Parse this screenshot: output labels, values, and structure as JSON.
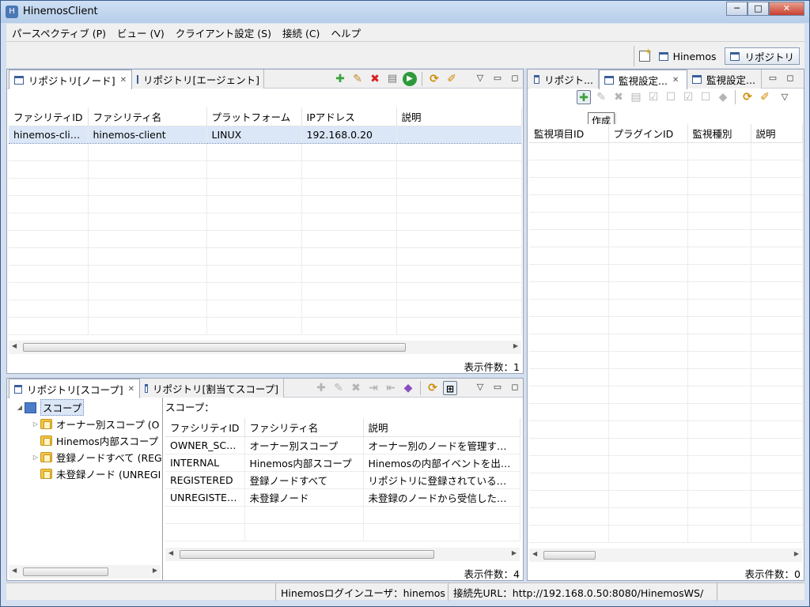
{
  "window": {
    "title": "HinemosClient",
    "minimize": "─",
    "maximize": "□",
    "close": "✕"
  },
  "menu": [
    "パースペクティブ (P)",
    "ビュー (V)",
    "クライアント設定 (S)",
    "接続 (C)",
    "ヘルプ"
  ],
  "perspectives": {
    "items": [
      "Hinemos",
      "リポジトリ"
    ],
    "active": "リポジトリ"
  },
  "node_panel": {
    "tabs": [
      {
        "label": "リポジトリ[ノード]",
        "active": true,
        "closable": true
      },
      {
        "label": "リポジトリ[エージェント]",
        "active": false,
        "closable": false
      }
    ],
    "columns": [
      "ファシリティID",
      "ファシリティ名",
      "プラットフォーム",
      "IPアドレス",
      "説明"
    ],
    "rows": [
      [
        "hinemos-client",
        "hinemos-client",
        "LINUX",
        "192.168.0.20",
        ""
      ]
    ],
    "count_label": "表示件数：1"
  },
  "scope_panel": {
    "tabs": [
      {
        "label": "リポジトリ[スコープ]",
        "active": true,
        "closable": true
      },
      {
        "label": "リポジトリ[割当てスコープ]",
        "active": false,
        "closable": false
      }
    ],
    "tree_root": "スコープ",
    "tree_items": [
      {
        "label": "オーナー別スコープ (O",
        "expandable": true
      },
      {
        "label": "Hinemos内部スコープ",
        "expandable": false
      },
      {
        "label": "登録ノードすべて (REG",
        "expandable": true
      },
      {
        "label": "未登録ノード (UNREGI",
        "expandable": false
      }
    ],
    "scope_label": "スコープ：",
    "columns": [
      "ファシリティID",
      "ファシリティ名",
      "説明"
    ],
    "rows": [
      [
        "OWNER_SCO...",
        "オーナー別スコープ",
        "オーナー別のノードを管理する..."
      ],
      [
        "INTERNAL",
        "Hinemos内部スコープ",
        "Hinemosの内部イベントを出力..."
      ],
      [
        "REGISTERED",
        "登録ノードすべて",
        "リポジトリに登録されているす..."
      ],
      [
        "UNREGISTER...",
        "未登録ノード",
        "未登録のノードから受信した通..."
      ]
    ],
    "count_label": "表示件数：4"
  },
  "monitor_panel": {
    "tabs": [
      {
        "label": "リポジト...",
        "active": false,
        "closable": false
      },
      {
        "label": "監視設定...",
        "active": true,
        "closable": true
      },
      {
        "label": "監視設定...",
        "active": false,
        "closable": false
      }
    ],
    "columns": [
      "監視項目ID",
      "プラグインID",
      "監視種別",
      "説明"
    ],
    "tooltip": "作成",
    "count_label": "表示件数：0"
  },
  "status": {
    "user": "Hinemosログインユーザ：hinemos",
    "url": "接続先URL：http://192.168.0.50:8080/HinemosWS/"
  }
}
